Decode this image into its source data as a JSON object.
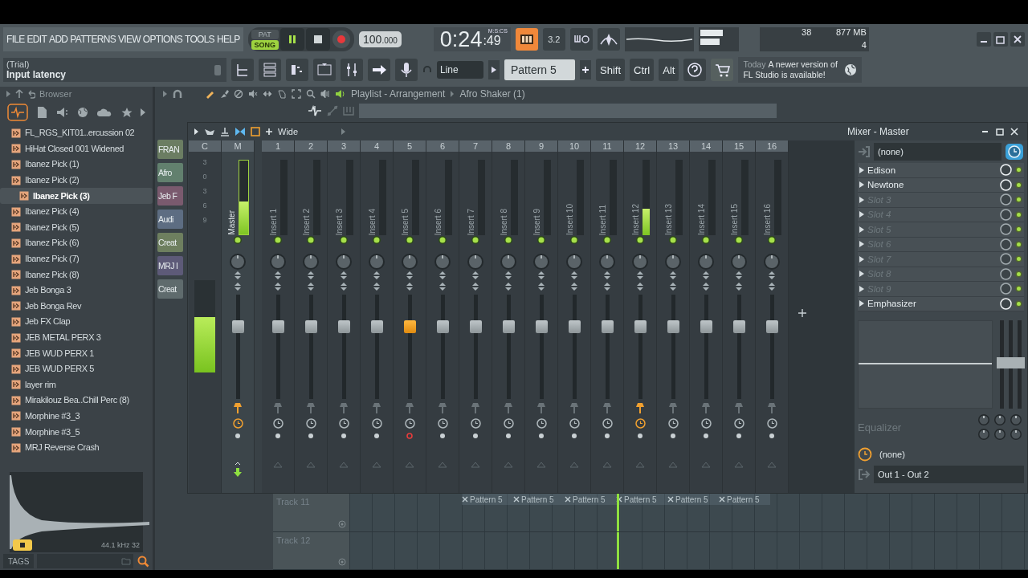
{
  "menu": [
    "FILE",
    "EDIT",
    "ADD",
    "PATTERNS",
    "VIEW",
    "OPTIONS",
    "TOOLS",
    "HELP"
  ],
  "hint": {
    "title": "(Trial)",
    "text": "Input latency"
  },
  "transport": {
    "modes": [
      {
        "label": "PAT",
        "selected": false
      },
      {
        "label": "SONG",
        "selected": true
      }
    ],
    "playing": true,
    "tempo": "100",
    "tempo_fraction": ".000"
  },
  "clock": {
    "format": "M:S:CS",
    "time": "0:24",
    "cs": ":49"
  },
  "step_badge": "3.2",
  "snap": "Line",
  "pattern": "Pattern 5",
  "keys": [
    "Shift",
    "Ctrl",
    "Alt"
  ],
  "monitor": {
    "cpu": "38",
    "memory": "877 MB",
    "polyphony": "4"
  },
  "news": {
    "date": "Today",
    "text": "A newer version of FL Studio is available!"
  },
  "browser": {
    "title": "Browser",
    "items": [
      {
        "label": "FL_RGS_KIT01..ercussion 02",
        "selected": false
      },
      {
        "label": "HiHat Closed 001 Widened",
        "selected": false
      },
      {
        "label": "Ibanez Pick (1)",
        "selected": false
      },
      {
        "label": "Ibanez Pick (2)",
        "selected": false
      },
      {
        "label": "Ibanez Pick (3)",
        "selected": true
      },
      {
        "label": "Ibanez Pick (4)",
        "selected": false
      },
      {
        "label": "Ibanez Pick (5)",
        "selected": false
      },
      {
        "label": "Ibanez Pick (6)",
        "selected": false
      },
      {
        "label": "Ibanez Pick (7)",
        "selected": false
      },
      {
        "label": "Ibanez Pick (8)",
        "selected": false
      },
      {
        "label": "Jeb Bonga 3",
        "selected": false
      },
      {
        "label": "Jeb Bonga Rev",
        "selected": false
      },
      {
        "label": "Jeb FX Clap",
        "selected": false
      },
      {
        "label": "JEB METAL PERX 3",
        "selected": false
      },
      {
        "label": "JEB WUD PERX 1",
        "selected": false
      },
      {
        "label": "JEB WUD PERX 5",
        "selected": false
      },
      {
        "label": "layer rim",
        "selected": false
      },
      {
        "label": "Mirakilouz Bea..Chill Perc (8)",
        "selected": false
      },
      {
        "label": "Morphine #3_3",
        "selected": false
      },
      {
        "label": "Morphine #3_5",
        "selected": false
      },
      {
        "label": "MRJ Reverse Crash",
        "selected": false
      }
    ],
    "sample_info": "44.1 kHz 32",
    "tags_label": "TAGS"
  },
  "playlist": {
    "title": "Playlist - Arrangement",
    "pattern": "Afro Shaker (1)",
    "clips": [
      {
        "label": "FRAN",
        "color": "#6b7d62"
      },
      {
        "label": "Afro",
        "color": "#62806e"
      },
      {
        "label": "Jeb F",
        "color": "#7a5a6e"
      },
      {
        "label": "Audi",
        "color": "#5d6d82"
      },
      {
        "label": "Creat",
        "color": "#6e7f5f"
      },
      {
        "label": "MRJ I",
        "color": "#5d5a78"
      },
      {
        "label": "Creat",
        "color": "#5f6b6d"
      }
    ],
    "tracks": [
      "Track 11",
      "Track 12"
    ],
    "pattern_clips": [
      "Pattern 5",
      "Pattern 5",
      "Pattern 5",
      "Pattern 5",
      "Pattern 5",
      "Pattern 5"
    ]
  },
  "mixer": {
    "title": "Mixer - Master",
    "stereo_mode": "Wide",
    "scale_header": "C",
    "scale": [
      "3",
      "0",
      "3",
      "6",
      "9"
    ],
    "input_meter": {
      "level": 0.6
    },
    "channels": [
      {
        "kind": "master",
        "header": "M",
        "name": "Master",
        "meter": {
          "level": 0.45
        },
        "fader": {
          "level": 0.72
        },
        "selected": false,
        "routed": true,
        "armed": false
      },
      {
        "kind": "insert",
        "header": "1",
        "name": "Insert 1",
        "meter": {
          "level": 0
        },
        "fader": {
          "level": 0.72
        },
        "selected": false,
        "routed": false,
        "armed": false
      },
      {
        "kind": "insert",
        "header": "2",
        "name": "Insert 2",
        "meter": {
          "level": 0
        },
        "fader": {
          "level": 0.72
        },
        "selected": false,
        "routed": false,
        "armed": false
      },
      {
        "kind": "insert",
        "header": "3",
        "name": "Insert 3",
        "meter": {
          "level": 0
        },
        "fader": {
          "level": 0.72
        },
        "selected": false,
        "routed": false,
        "armed": false
      },
      {
        "kind": "insert",
        "header": "4",
        "name": "Insert 4",
        "meter": {
          "level": 0
        },
        "fader": {
          "level": 0.72
        },
        "selected": false,
        "routed": false,
        "armed": false
      },
      {
        "kind": "insert",
        "header": "5",
        "name": "Insert 5",
        "meter": {
          "level": 0
        },
        "fader": {
          "level": 0.72
        },
        "selected": true,
        "routed": false,
        "armed": true
      },
      {
        "kind": "insert",
        "header": "6",
        "name": "Insert 6",
        "meter": {
          "level": 0
        },
        "fader": {
          "level": 0.72
        },
        "selected": false,
        "routed": false,
        "armed": false
      },
      {
        "kind": "insert",
        "header": "7",
        "name": "Insert 7",
        "meter": {
          "level": 0
        },
        "fader": {
          "level": 0.72
        },
        "selected": false,
        "routed": false,
        "armed": false
      },
      {
        "kind": "insert",
        "header": "8",
        "name": "Insert 8",
        "meter": {
          "level": 0
        },
        "fader": {
          "level": 0.72
        },
        "selected": false,
        "routed": false,
        "armed": false
      },
      {
        "kind": "insert",
        "header": "9",
        "name": "Insert 9",
        "meter": {
          "level": 0
        },
        "fader": {
          "level": 0.72
        },
        "selected": false,
        "routed": false,
        "armed": false
      },
      {
        "kind": "insert",
        "header": "10",
        "name": "Insert 10",
        "meter": {
          "level": 0
        },
        "fader": {
          "level": 0.72
        },
        "selected": false,
        "routed": false,
        "armed": false
      },
      {
        "kind": "insert",
        "header": "11",
        "name": "Insert 11",
        "meter": {
          "level": 0
        },
        "fader": {
          "level": 0.72
        },
        "selected": false,
        "routed": false,
        "armed": false
      },
      {
        "kind": "insert",
        "header": "12",
        "name": "Insert 12",
        "meter": {
          "level": 0.35
        },
        "fader": {
          "level": 0.72
        },
        "selected": false,
        "routed": true,
        "armed": false
      },
      {
        "kind": "insert",
        "header": "13",
        "name": "Insert 13",
        "meter": {
          "level": 0
        },
        "fader": {
          "level": 0.72
        },
        "selected": false,
        "routed": false,
        "armed": false
      },
      {
        "kind": "insert",
        "header": "14",
        "name": "Insert 14",
        "meter": {
          "level": 0
        },
        "fader": {
          "level": 0.72
        },
        "selected": false,
        "routed": false,
        "armed": false
      },
      {
        "kind": "insert",
        "header": "15",
        "name": "Insert 15",
        "meter": {
          "level": 0
        },
        "fader": {
          "level": 0.72
        },
        "selected": false,
        "routed": false,
        "armed": false
      },
      {
        "kind": "insert",
        "header": "16",
        "name": "Insert 16",
        "meter": {
          "level": 0
        },
        "fader": {
          "level": 0.72
        },
        "selected": false,
        "routed": false,
        "armed": false
      }
    ],
    "slots": [
      {
        "label": "Edison",
        "filled": true
      },
      {
        "label": "Newtone",
        "filled": true
      },
      {
        "label": "Slot 3",
        "filled": false
      },
      {
        "label": "Slot 4",
        "filled": false
      },
      {
        "label": "Slot 5",
        "filled": false
      },
      {
        "label": "Slot 6",
        "filled": false
      },
      {
        "label": "Slot 7",
        "filled": false
      },
      {
        "label": "Slot 8",
        "filled": false
      },
      {
        "label": "Slot 9",
        "filled": false
      },
      {
        "label": "Emphasizer",
        "filled": true
      }
    ],
    "input": "(none)",
    "eq_label": "Equalizer",
    "latency": "(none)",
    "output": "Out 1 - Out 2"
  }
}
